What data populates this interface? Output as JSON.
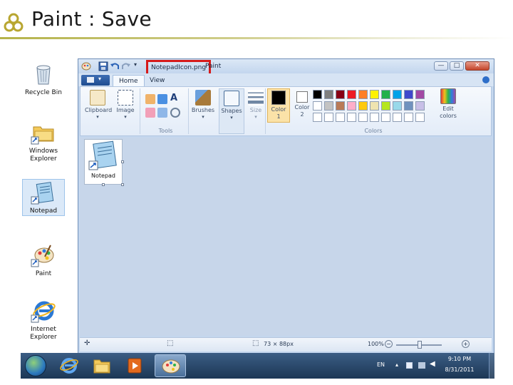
{
  "slide": {
    "title": "Paint : Save"
  },
  "desktop": {
    "icons": [
      {
        "label": "Recycle Bin",
        "icon": "recycle-bin-icon"
      },
      {
        "label": "Windows Explorer",
        "icon": "folder-icon"
      },
      {
        "label": "Notepad",
        "icon": "notepad-icon",
        "selected": true
      },
      {
        "label": "Paint",
        "icon": "palette-icon"
      },
      {
        "label": "Internet Explorer",
        "icon": "ie-icon"
      }
    ]
  },
  "window": {
    "file_title": "NotepadIcon.png",
    "app_title": "Paint",
    "controls": {
      "minimize": "—",
      "maximize": "□",
      "close": "✕"
    }
  },
  "tabs": [
    {
      "label": "Home",
      "active": true
    },
    {
      "label": "View",
      "active": false
    }
  ],
  "ribbon": {
    "clipboard": {
      "label": "Clipboard"
    },
    "image": {
      "label": "Image"
    },
    "tools_group": "Tools",
    "brushes": {
      "label": "Brushes"
    },
    "shapes": {
      "label": "Shapes"
    },
    "size": {
      "label": "Size"
    },
    "color1": {
      "label": "Color",
      "num": "1"
    },
    "color2": {
      "label": "Color",
      "num": "2"
    },
    "colors_group": "Colors",
    "edit_colors": {
      "line1": "Edit",
      "line2": "colors"
    }
  },
  "palette": {
    "row1": [
      "#000000",
      "#7f7f7f",
      "#880015",
      "#ed1c24",
      "#ff7f27",
      "#fff200",
      "#22b14c",
      "#00a2e8",
      "#3f48cc",
      "#a349a4"
    ],
    "row2": [
      "#ffffff",
      "#c3c3c3",
      "#b97a57",
      "#ffaec9",
      "#ffc90e",
      "#efe4b0",
      "#b5e61d",
      "#99d9ea",
      "#7092be",
      "#c8bfe7"
    ],
    "row3": [
      "#ffffff",
      "#ffffff",
      "#ffffff",
      "#ffffff",
      "#ffffff",
      "#ffffff",
      "#ffffff",
      "#ffffff",
      "#ffffff",
      "#ffffff"
    ]
  },
  "canvas": {
    "label": "Notepad"
  },
  "status": {
    "dimensions": "73 × 88px",
    "zoom": "100%"
  },
  "taskbar": {
    "lang": "EN",
    "time": "9:10 PM",
    "date": "8/31/2011"
  }
}
